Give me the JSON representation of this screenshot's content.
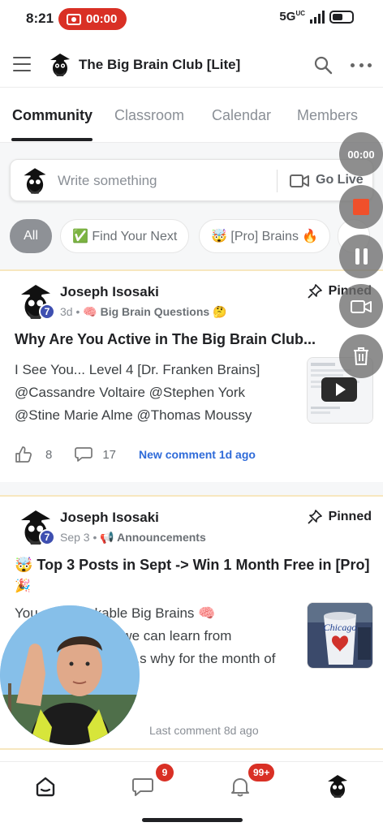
{
  "status_bar": {
    "time": "8:21",
    "recording_time": "00:00",
    "network": "5G",
    "network_sub": "UC"
  },
  "header": {
    "title": "The Big Brain Club [Lite]",
    "icons": [
      "menu-icon",
      "search-icon",
      "more-icon"
    ]
  },
  "tabs": [
    {
      "label": "Community",
      "active": true
    },
    {
      "label": "Classroom",
      "active": false
    },
    {
      "label": "Calendar",
      "active": false
    },
    {
      "label": "Members",
      "active": false
    }
  ],
  "composer": {
    "placeholder": "Write something",
    "go_live": "Go Live"
  },
  "chips": [
    {
      "label": "All"
    },
    {
      "label": "✅ Find Your Next"
    },
    {
      "label": "🤯 [Pro] Brains 🔥"
    }
  ],
  "posts": [
    {
      "author": "Joseph Isosaki",
      "level": "7",
      "time": "3d",
      "sep": "•",
      "category": "🧠 Big Brain Questions 🤔",
      "pinned": "Pinned",
      "title": "Why Are You Active in The Big Brain Club...",
      "body_lines": [
        "I See You... Level 4 [Dr. Franken Brains]",
        "@Cassandre Voltaire @Stephen York",
        "@Stine Marie Alme @Thomas Moussy"
      ],
      "likes": "8",
      "comments": "17",
      "comment_status": "New comment 1d ago"
    },
    {
      "author": "Joseph Isosaki",
      "level": "7",
      "time": "Sep 3",
      "sep": "•",
      "category": "📢 Announcements",
      "pinned": "Pinned",
      "title": "🤯 Top 3 Posts in Sept -> Win 1 Month Free in [Pro]",
      "title_line2": "🎉",
      "body_lines": [
        "You... Remarkable Big Brains 🧠",
        "...uch we can learn from",
        "...s why for the month of"
      ],
      "comment_status": "Last comment 8d ago"
    }
  ],
  "recorder": {
    "timer": "00:00",
    "buttons": [
      "stop-icon",
      "pause-icon",
      "camera-toggle-icon",
      "trash-icon"
    ],
    "stop_color": "#f0502b"
  },
  "bottom_nav": {
    "chat_badge": "9",
    "notifications_badge": "99+"
  },
  "colors": {
    "accent_link": "#2f6bd9",
    "recording_red": "#d93025",
    "level_badge": "#3e4fb0"
  }
}
